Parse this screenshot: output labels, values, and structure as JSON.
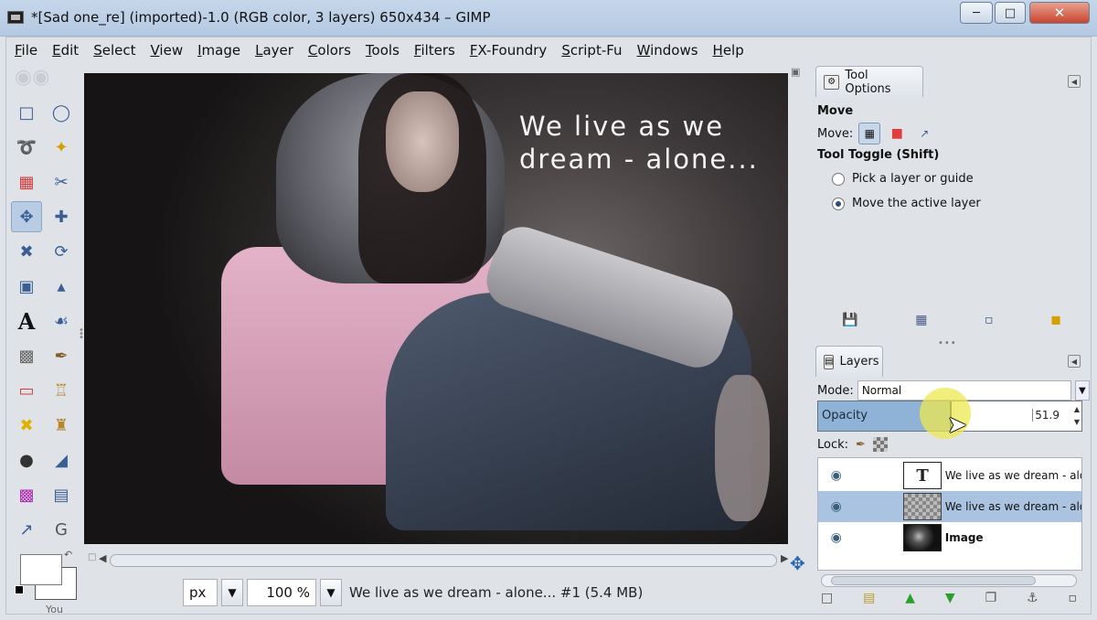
{
  "window": {
    "title": "*[Sad one_re] (imported)-1.0 (RGB color, 3 layers) 650x434 – GIMP",
    "minimize": "─",
    "maximize": "□",
    "close": "✕"
  },
  "menu": [
    "File",
    "Edit",
    "Select",
    "View",
    "Image",
    "Layer",
    "Colors",
    "Tools",
    "Filters",
    "FX-Foundry",
    "Script-Fu",
    "Windows",
    "Help"
  ],
  "canvas": {
    "quote_line1": "We live as we",
    "quote_line2": "dream - alone..."
  },
  "toolbox": {
    "you_label": "You"
  },
  "statusbar": {
    "unit": "px",
    "zoom": "100 %",
    "message": "We live as we dream - alone... #1 (5.4 MB)"
  },
  "tool_options": {
    "tab_label": "Tool Options",
    "heading": "Move",
    "move_label": "Move:",
    "toggle_label": "Tool Toggle  (Shift)",
    "option1": "Pick a layer or guide",
    "option2": "Move the active layer"
  },
  "layers_panel": {
    "tab_label": "Layers",
    "mode_label": "Mode:",
    "mode_value": "Normal",
    "opacity_label": "Opacity",
    "opacity_value": "51.9",
    "opacity_fraction": 0.519,
    "lock_label": "Lock:",
    "layers": [
      {
        "name": "We live as we dream - alo",
        "thumb": "T",
        "selected": false
      },
      {
        "name": "We live as we dream - alo",
        "thumb": "",
        "selected": true
      },
      {
        "name": "Image",
        "thumb": "",
        "selected": false
      }
    ]
  },
  "colors": {
    "selection": "#a9c3e0",
    "opacity_fill": "#8fb3d6",
    "cursor_highlight": "#ece850"
  }
}
